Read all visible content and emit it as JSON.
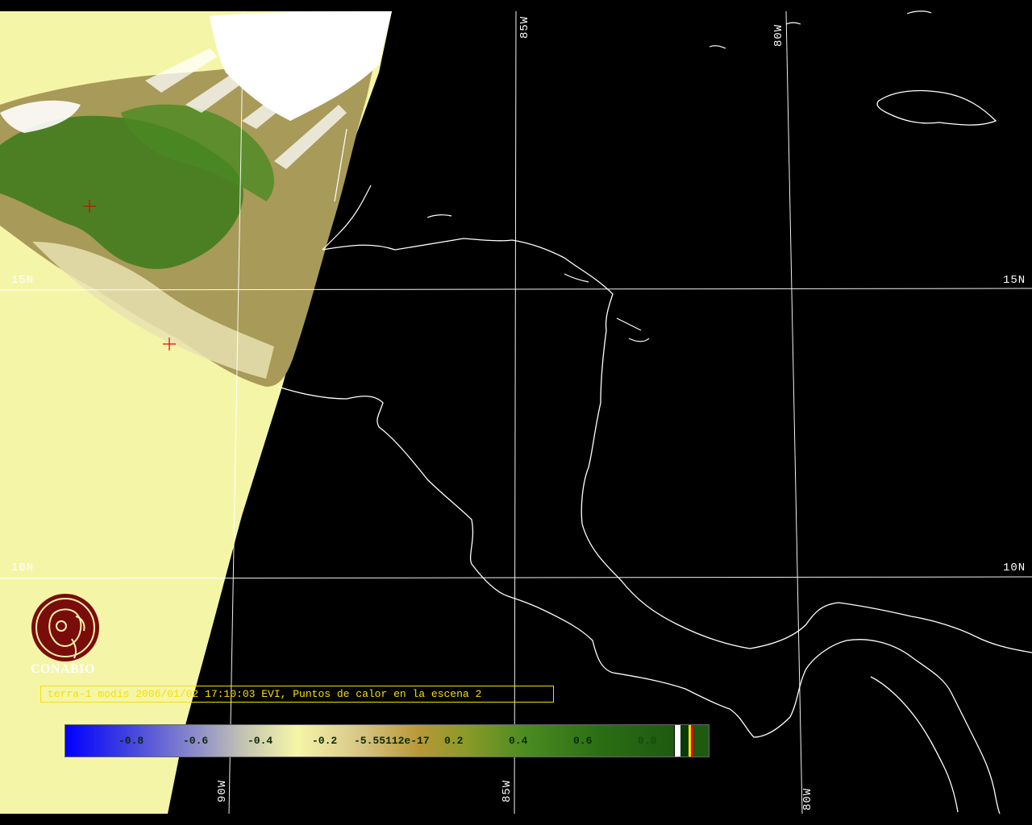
{
  "map": {
    "graticule": {
      "lat_labels": {
        "top": "15N",
        "bottom": "10N"
      },
      "lon_labels": {
        "w90": "90W",
        "w85": "85W",
        "w80": "80W"
      }
    },
    "markers": [
      "hotspot-1",
      "hotspot-2"
    ]
  },
  "logo": {
    "org_name": "CONABIO"
  },
  "caption": {
    "text": "terra-1 modis 2006/01/02 17:10:03 EVI, Puntos de calor en la escena 2"
  },
  "colorbar": {
    "ticks": [
      "-0.8",
      "-0.6",
      "-0.4",
      "-0.2",
      "-5.55112e-17",
      "0.2",
      "0.4",
      "0.6",
      "0.8"
    ],
    "colors": {
      "low": "#0000ff",
      "mid": "#f5f5a8",
      "high": "#1e5a10"
    }
  },
  "colors": {
    "background": "#000000",
    "no_data": "#f5f5a8",
    "coastline": "#ffffff",
    "marker": "#e00000",
    "caption": "#f5e000"
  }
}
